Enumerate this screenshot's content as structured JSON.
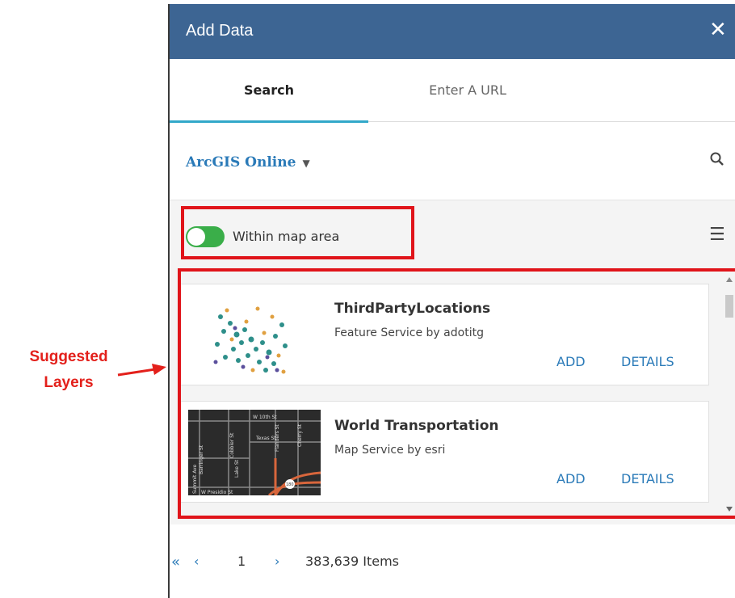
{
  "annotation": {
    "label_line1": "Suggested",
    "label_line2": "Layers",
    "color": "#e0141a"
  },
  "panel": {
    "title": "Add Data",
    "close_icon": "close-icon",
    "header_color": "#3d6593"
  },
  "tabs": [
    {
      "label": "Search",
      "active": true
    },
    {
      "label": "Enter A URL",
      "active": false
    }
  ],
  "source": {
    "label": "ArcGIS Online",
    "caret": "▼",
    "search_icon": "search-icon"
  },
  "filter": {
    "toggle_on": true,
    "toggle_label": "Within map area",
    "menu_icon": "hamburger-menu-icon"
  },
  "results": [
    {
      "title": "ThirdPartyLocations",
      "subtitle": "Feature Service by adotitg",
      "add_label": "ADD",
      "details_label": "DETAILS",
      "thumbnail": "scatter-points-thumbnail"
    },
    {
      "title": "World Transportation",
      "subtitle": "Map Service by esri",
      "add_label": "ADD",
      "details_label": "DETAILS",
      "thumbnail": "street-map-thumbnail",
      "map_labels": [
        "W 10th St",
        "Texas St",
        "Barringer St",
        "Cobbler St",
        "Lake St",
        "Flanders St",
        "Cherry St",
        "Summit Ave",
        "W Presidio St",
        "180"
      ]
    }
  ],
  "pagination": {
    "first": "«",
    "prev": "‹",
    "page": "1",
    "next": "›",
    "total": "383,639 Items"
  },
  "accent_color": "#2a7ab8",
  "toggle_color": "#3aae49"
}
